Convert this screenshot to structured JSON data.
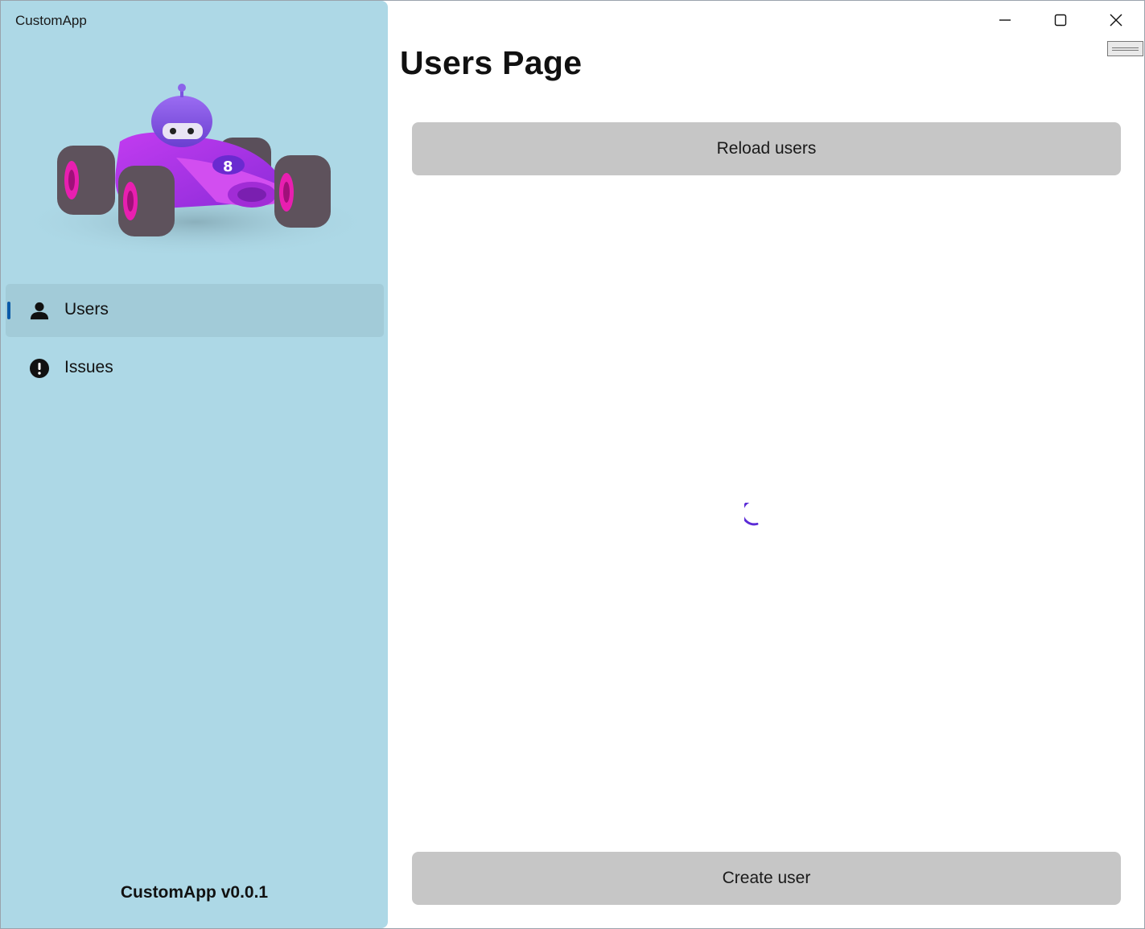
{
  "app": {
    "title": "CustomApp",
    "version": "CustomApp v0.0.1"
  },
  "caption": {
    "minimize_icon": "minimize-icon",
    "maximize_icon": "maximize-icon",
    "close_icon": "close-icon"
  },
  "sidebar": {
    "hero_image": "race-car-robot-illustration",
    "items": [
      {
        "label": "Users",
        "icon": "person-icon",
        "selected": true
      },
      {
        "label": "Issues",
        "icon": "exclamation-circle-icon",
        "selected": false
      }
    ]
  },
  "main": {
    "title": "Users Page",
    "reload_label": "Reload users",
    "create_label": "Create user",
    "loading": true
  },
  "colors": {
    "sidebar_bg": "#add8e6",
    "selected_item_bg": "#a2cbd8",
    "accent_indicator": "#0a5aa8",
    "button_bg": "#c6c6c6",
    "spinner": "#5b2bd6"
  }
}
